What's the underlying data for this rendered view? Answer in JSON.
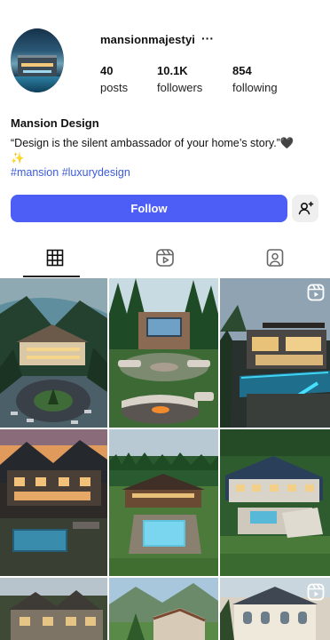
{
  "profile": {
    "username": "mansionmajestyi",
    "more_icon": "···",
    "stats": [
      {
        "value": "40",
        "label": "posts"
      },
      {
        "value": "10.1K",
        "label": "followers"
      },
      {
        "value": "854",
        "label": "following"
      }
    ],
    "display_name": "Mansion Design",
    "bio": "“Design is the silent ambassador of your home’s story.”🖤✨",
    "hashtags": [
      "#mansion",
      "#luxurydesign"
    ]
  },
  "actions": {
    "follow_label": "Follow",
    "suggest_icon": "add-person-icon"
  },
  "tabs": [
    {
      "name": "posts",
      "icon": "grid-icon",
      "selected": true
    },
    {
      "name": "reels",
      "icon": "reels-icon",
      "selected": false
    },
    {
      "name": "tagged",
      "icon": "tagged-person-icon",
      "selected": false
    }
  ],
  "posts": [
    {
      "subject": "lakeside-mansion-aerial",
      "badge": null
    },
    {
      "subject": "backyard-firepit-garden",
      "badge": null
    },
    {
      "subject": "modern-villa-infinity-pool",
      "badge": "reel-icon"
    },
    {
      "subject": "dark-roof-estate-sunset",
      "badge": null
    },
    {
      "subject": "log-mansion-pool-aerial",
      "badge": null
    },
    {
      "subject": "estate-garden-aerial",
      "badge": null
    },
    {
      "subject": "stone-manor-gabled",
      "badge": null
    },
    {
      "subject": "hillside-tropical-villa",
      "badge": null
    },
    {
      "subject": "white-chateau-facade",
      "badge": "reel-icon"
    }
  ],
  "colors": {
    "follow_button": "#4d5ef7",
    "hashtag": "#3b5bdb",
    "secondary_button": "#efefef"
  }
}
